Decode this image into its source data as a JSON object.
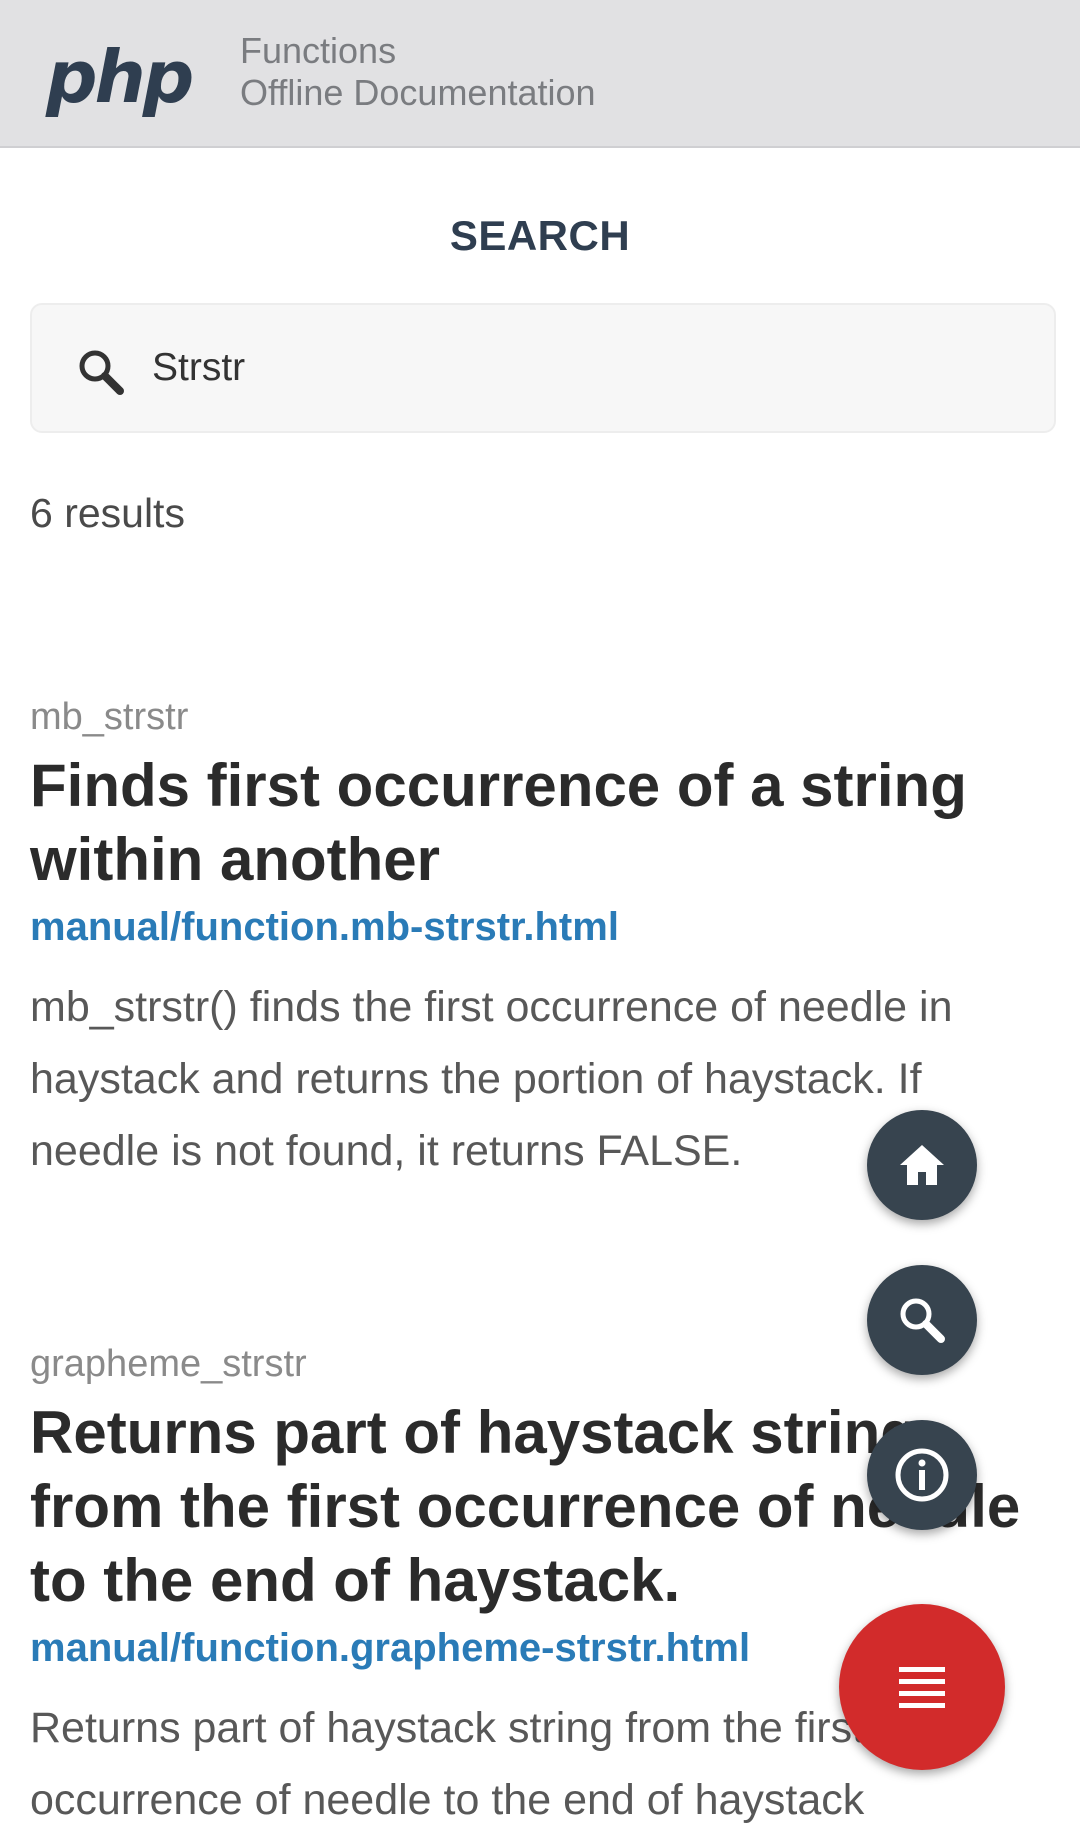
{
  "header": {
    "logo_text": "php",
    "title_line1": "Functions",
    "title_line2": "Offline Documentation"
  },
  "search": {
    "section_title": "SEARCH",
    "value": "Strstr",
    "placeholder": ""
  },
  "results_count": "6 results",
  "results": [
    {
      "function": "mb_strstr",
      "title": "Finds first occurrence of a string within another",
      "link": "manual/function.mb-strstr.html",
      "description": "mb_strstr() finds the first occurrence of needle in haystack and returns the portion of haystack. If needle is not found, it returns FALSE."
    },
    {
      "function": "grapheme_strstr",
      "title": "Returns part of haystack string from the first occurrence of needle to the end of haystack.",
      "link": "manual/function.grapheme-strstr.html",
      "description": "Returns part of haystack string from the first occurrence of needle to the end of haystack"
    }
  ],
  "fabs": {
    "home": "home-icon",
    "search": "search-icon",
    "info": "info-icon",
    "menu": "menu-icon"
  },
  "colors": {
    "header_bg": "#e1e1e3",
    "link": "#2a7bb7",
    "fab_dark": "#37444f",
    "fab_accent": "#d22b2b"
  }
}
